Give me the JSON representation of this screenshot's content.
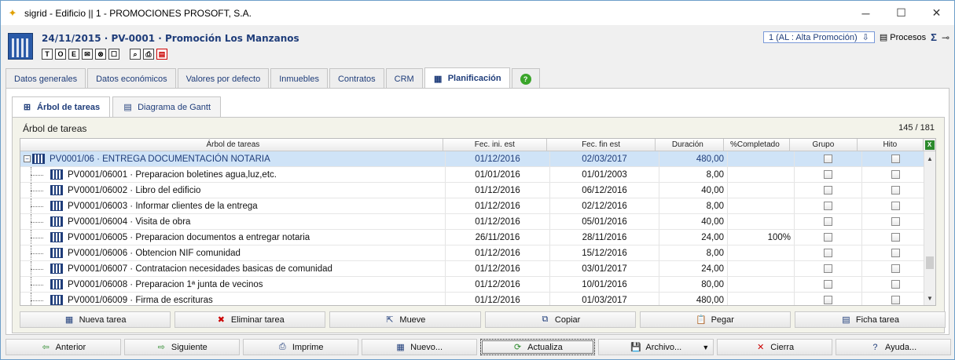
{
  "window": {
    "title": "sigrid - Edificio || 1 - PROMOCIONES PROSOFT, S.A.",
    "minimize": "─",
    "maximize": "☐",
    "close": "✕"
  },
  "header": {
    "title": "24/11/2015 · PV-0001 · Promoción Los Manzanos",
    "tools": [
      "T",
      "O",
      "E",
      "✉",
      "⊗",
      "☐"
    ],
    "tools2": [
      "⌕",
      "⎙",
      "▤"
    ],
    "state_select": "1 (AL : Alta Promoción)",
    "procesos": "Procesos",
    "sigma": "Σ",
    "pin": "⊸"
  },
  "tabs": [
    {
      "label": "Datos generales"
    },
    {
      "label": "Datos económicos"
    },
    {
      "label": "Valores por defecto"
    },
    {
      "label": "Inmuebles"
    },
    {
      "label": "Contratos"
    },
    {
      "label": "CRM"
    },
    {
      "label": "Planificación"
    }
  ],
  "help_tab": "?",
  "subtabs": [
    {
      "label": "Árbol de tareas"
    },
    {
      "label": "Diagrama de Gantt"
    }
  ],
  "panel": {
    "title": "Árbol de tareas",
    "count": "145 / 181"
  },
  "grid": {
    "columns": [
      "Árbol de tareas",
      "Fec. ini. est",
      "Fec. fin est",
      "Duración",
      "%Completado",
      "Grupo",
      "Hito"
    ],
    "excel": "X",
    "parent": {
      "name": "PV0001/06 · ENTREGA DOCUMENTACIÓN NOTARIA",
      "ini": "01/12/2016",
      "fin": "02/03/2017",
      "dur": "480,00",
      "pct": ""
    },
    "rows": [
      {
        "name": "PV0001/06001 · Preparacion boletines agua,luz,etc.",
        "ini": "01/01/2016",
        "fin": "01/01/2003",
        "dur": "8,00",
        "pct": ""
      },
      {
        "name": "PV0001/06002 · Libro del edificio",
        "ini": "01/12/2016",
        "fin": "06/12/2016",
        "dur": "40,00",
        "pct": ""
      },
      {
        "name": "PV0001/06003 · Informar clientes de la entrega",
        "ini": "01/12/2016",
        "fin": "02/12/2016",
        "dur": "8,00",
        "pct": ""
      },
      {
        "name": "PV0001/06004 · Visita de obra",
        "ini": "01/12/2016",
        "fin": "05/01/2016",
        "dur": "40,00",
        "pct": ""
      },
      {
        "name": "PV0001/06005 · Preparacion documentos a entregar notaria",
        "ini": "26/11/2016",
        "fin": "28/11/2016",
        "dur": "24,00",
        "pct": "100%"
      },
      {
        "name": "PV0001/06006 · Obtencion NIF comunidad",
        "ini": "01/12/2016",
        "fin": "15/12/2016",
        "dur": "8,00",
        "pct": ""
      },
      {
        "name": "PV0001/06007 · Contratacion necesidades basicas de comunidad",
        "ini": "01/12/2016",
        "fin": "03/01/2017",
        "dur": "24,00",
        "pct": ""
      },
      {
        "name": "PV0001/06008 · Preparacion 1ª junta de vecinos",
        "ini": "01/12/2016",
        "fin": "10/01/2016",
        "dur": "80,00",
        "pct": ""
      },
      {
        "name": "PV0001/06009 · Firma de escrituras",
        "ini": "01/12/2016",
        "fin": "01/03/2017",
        "dur": "480,00",
        "pct": ""
      }
    ]
  },
  "action_buttons": [
    {
      "label": "Nueva tarea",
      "icon": "▦"
    },
    {
      "label": "Eliminar tarea",
      "icon": "✖"
    },
    {
      "label": "Mueve",
      "icon": "⇱"
    },
    {
      "label": "Copiar",
      "icon": "⧉"
    },
    {
      "label": "Pegar",
      "icon": "📋"
    },
    {
      "label": "Ficha tarea",
      "icon": "▤"
    }
  ],
  "bottom_buttons": [
    {
      "label": "Anterior",
      "icon": "⇦"
    },
    {
      "label": "Siguiente",
      "icon": "⇨"
    },
    {
      "label": "Imprime",
      "icon": "⎙"
    },
    {
      "label": "Nuevo...",
      "icon": "▦"
    },
    {
      "label": "Actualiza",
      "icon": "⟳"
    },
    {
      "label": "Archivo...",
      "icon": "💾"
    },
    {
      "label": "Cierra",
      "icon": "✕"
    },
    {
      "label": "Ayuda...",
      "icon": "?"
    }
  ]
}
